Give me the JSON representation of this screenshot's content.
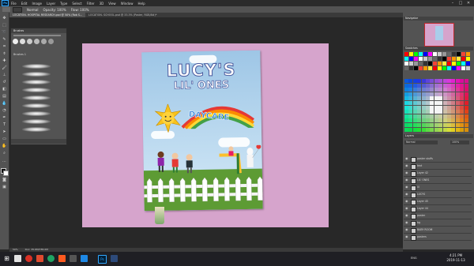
{
  "app": {
    "logo": "Ps",
    "menu": [
      "File",
      "Edit",
      "Image",
      "Layer",
      "Type",
      "Select",
      "Filter",
      "3D",
      "View",
      "Window",
      "Help"
    ],
    "window_controls": [
      "–",
      "□",
      "✕"
    ]
  },
  "options_bar": {
    "mode_label": "Normal",
    "opacity_label": "Opacity: 100%",
    "flow_label": "Flow: 100%"
  },
  "tabs": [
    {
      "label": "LOCATION- HOSPITAL RESEARCH.psd @ 50% (Rob S...",
      "active": true
    },
    {
      "label": "LOCATION- SCHOOL.psd @ 33.3% (Poster, RGB/8#)*",
      "active": false
    }
  ],
  "brushes_panel": {
    "title": "Brushes",
    "group_label": "Brushes 1"
  },
  "poster": {
    "title_line1": "LUCY'S",
    "title_line2": "LIL' ONES",
    "badge": "DAYCARE"
  },
  "panels": {
    "navigator_title": "Navigator",
    "swatches_title": "Swatches",
    "layers_title": "Layers",
    "layers_mode": "Normal",
    "layers_opacity": "100%",
    "layers": [
      "poster stuffs",
      "text",
      "Layer 42",
      "LIL' ONES",
      "lil",
      "LUCYS",
      "Layer 45",
      "Layer 44",
      "poster",
      "bg",
      "BABY ROOM",
      "posters"
    ]
  },
  "status_bar": {
    "zoom": "50%",
    "doc_info": "Doc: 35.6M/785.0M"
  },
  "taskbar": {
    "time": "4:21 PM",
    "date": "2019-11-13",
    "lang": "ENG"
  },
  "colors": {
    "canvas_bg": "#d6a4cc",
    "workspace": "#282828",
    "panel": "#535353",
    "accent": "#31a8ff"
  }
}
